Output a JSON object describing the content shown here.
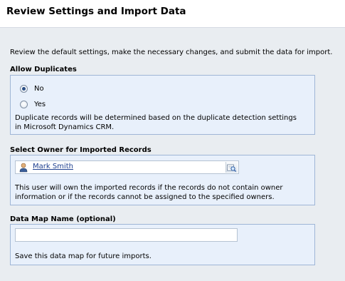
{
  "header": {
    "title": "Review Settings and Import Data"
  },
  "intro_text": "Review the default settings, make the necessary changes, and submit the data for import.",
  "duplicates": {
    "label": "Allow Duplicates",
    "options": [
      {
        "label": "No",
        "selected": true
      },
      {
        "label": "Yes",
        "selected": false
      }
    ],
    "note_line1": "Duplicate records will be determined based on the duplicate detection settings",
    "note_line2": "in Microsoft Dynamics CRM."
  },
  "owner": {
    "label": "Select Owner for Imported Records",
    "value": "Mark Smith",
    "icon": "user-icon",
    "lookup_icon": "lookup-search-icon",
    "note_line1": "This user will own the imported records if the records do not contain owner",
    "note_line2": "information or if the records cannot be assigned to the specified owners."
  },
  "data_map": {
    "label": "Data Map Name (optional)",
    "value": "",
    "note": "Save this data map for future imports."
  },
  "colors": {
    "panel_bg": "#e8f0fb",
    "panel_border": "#9fb6d6",
    "page_bg": "#e9edf1",
    "link": "#1d3f8f"
  }
}
